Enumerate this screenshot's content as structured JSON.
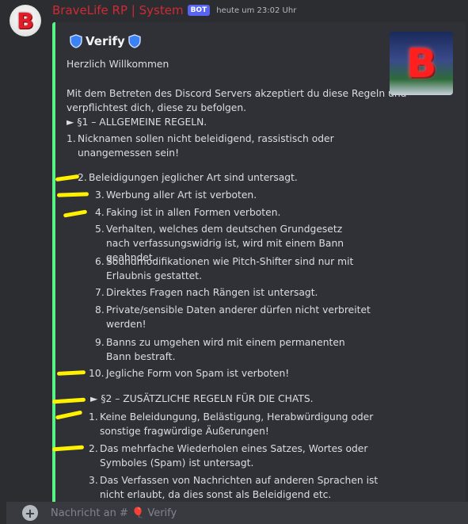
{
  "message": {
    "username": "BraveLife RP | System",
    "bot_badge": "BOT",
    "timestamp": "heute um 23:02 Uhr",
    "avatar_letter": "B"
  },
  "embed": {
    "title": "Verify",
    "greeting": "Herzlich Willkommen",
    "intro": "Mit dem Betreten des Discord Servers akzeptiert du diese Regeln und verpflichtest dich, diese zu befolgen.",
    "section1": "► §1 – ALLGEMEINE REGELN.",
    "rules1": [
      {
        "num": "1.",
        "text": "Nicknamen sollen nicht beleidigend, rassistisch oder unangemessen sein!"
      },
      {
        "num": "2.",
        "text": "Beleidigungen jeglicher Art sind untersagt."
      },
      {
        "num": "3.",
        "text": "Werbung aller Art ist verboten."
      },
      {
        "num": "4.",
        "text": "Faking ist in allen Formen verboten."
      },
      {
        "num": "5.",
        "text": "Verhalten, welches dem deutschen Grundgesetz nach verfassungswidrig ist, wird mit einem Bann geahndet."
      },
      {
        "num": "6.",
        "text": "Soundmodifikationen wie Pitch-Shifter sind nur mit Erlaubnis gestattet."
      },
      {
        "num": "7.",
        "text": "Direktes Fragen nach Rängen ist untersagt."
      },
      {
        "num": "8.",
        "text": "Private/sensible Daten anderer dürfen nicht verbreitet werden!"
      },
      {
        "num": "9.",
        "text": "Banns zu umgehen wird mit einem permanenten Bann bestraft."
      },
      {
        "num": "10.",
        "text": "Jegliche Form von Spam ist verboten!"
      }
    ],
    "section2": "► §2 – ZUSÄTZLICHE REGELN FÜR DIE CHATS.",
    "rules2": [
      {
        "num": "1.",
        "text": "Keine Beleidungung, Belästigung, Herabwürdigung oder sonstige fragwürdige Äußerungen!"
      },
      {
        "num": "2.",
        "text": "Das mehrfache Wiederholen eines Satzes, Wortes oder Symboles (Spam) ist untersagt."
      },
      {
        "num": "3.",
        "text": "Das Verfassen von Nachrichten auf anderen Sprachen ist nicht erlaubt, da dies sonst als Beleidigend etc. angesehen"
      }
    ],
    "thumbnail_letter": "B"
  },
  "composer": {
    "placeholder": "Nachricht an # 🎈 Verify"
  },
  "colors": {
    "accent_bar": "#58f287",
    "username": "#d02a35",
    "bot_badge": "#5865f2",
    "highlight": "#fff100"
  }
}
